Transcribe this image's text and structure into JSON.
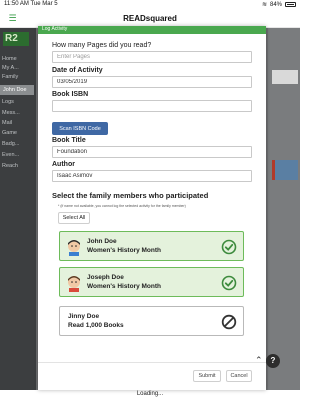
{
  "status_bar": {
    "time": "11:50 AM",
    "date": "Tue Mar 5",
    "battery": "84%"
  },
  "app": {
    "title": "READsquared"
  },
  "sidebar": {
    "logo": "R2",
    "items": [
      "Home",
      "My A...",
      "Family",
      "John Doe",
      "Logs",
      "Mess...",
      "Mail",
      "Game",
      "Badg...",
      "Even...",
      "Reach"
    ]
  },
  "modal": {
    "header": "Log Activity",
    "pages": {
      "label": "How many Pages did you read?",
      "placeholder": "Enter Pages",
      "value": ""
    },
    "date": {
      "label": "Date of Activity",
      "value": "03/05/2019"
    },
    "isbn": {
      "label": "Book ISBN",
      "value": ""
    },
    "scan_button": "Scan ISBN Code",
    "title": {
      "label": "Book Title",
      "value": "Foundation"
    },
    "author": {
      "label": "Author",
      "value": "Isaac Asimov"
    },
    "members_title": "Select the family members who participated",
    "members_note": "* (if name not available, you cannot log the selected activity for the family member)",
    "select_all": "Select All",
    "members": [
      {
        "name": "John Doe",
        "activity": "Women's History Month",
        "selected": true,
        "status_icon": "check-circle-icon"
      },
      {
        "name": "Joseph Doe",
        "activity": "Women's History Month",
        "selected": true,
        "status_icon": "check-circle-icon"
      },
      {
        "name": "Jinny Doe",
        "activity": "Read 1,000 Books",
        "selected": false,
        "status_icon": "not-allowed-icon"
      }
    ],
    "submit": "Submit",
    "cancel": "Cancel"
  },
  "help_label": "?",
  "loading_text": "Loading...",
  "colors": {
    "brand_green": "#4aa84f",
    "scan_blue": "#3f68a4",
    "selected_bg": "#e4f2dc"
  }
}
